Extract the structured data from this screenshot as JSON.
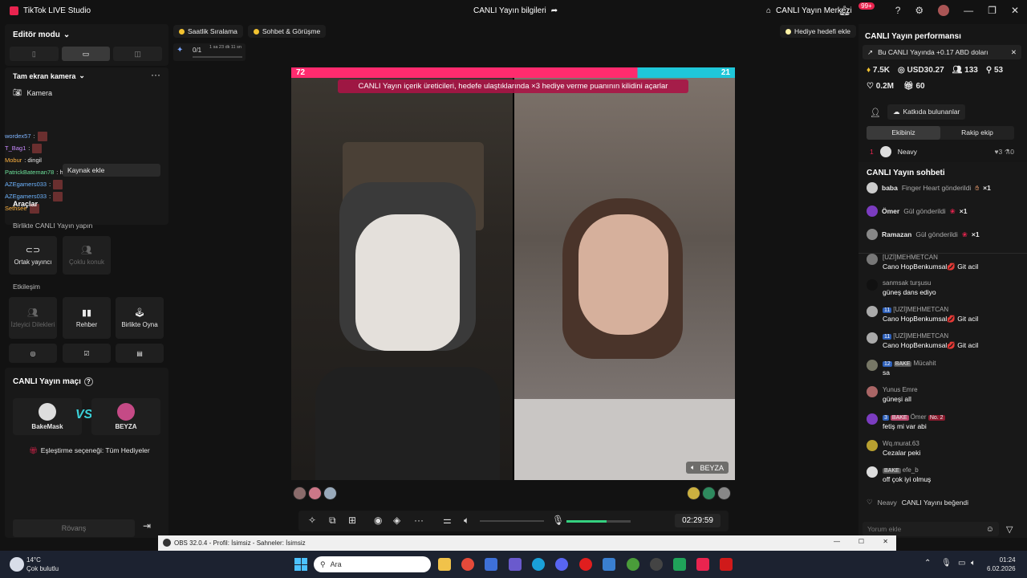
{
  "titlebar": {
    "app_title": "TikTok LIVE Studio",
    "center_title": "CANLI Yayın bilgileri",
    "live_center": "CANLI Yayın Merkezi",
    "notif_badge": "99+"
  },
  "left": {
    "editor_mode": "Editör modu",
    "fullscreen_camera": "Tam ekran kamera",
    "camera_label": "Kamera",
    "add_source": "Kaynak ekle",
    "tools_label": "Araçlar",
    "overlay_chat": [
      {
        "user": "wordex57",
        "text": ":"
      },
      {
        "user": "T_Bag1",
        "text": ":"
      },
      {
        "user": "Mobur",
        "text": ": dingil"
      },
      {
        "user": "PatrickBateman78",
        "text": ": he anladım"
      },
      {
        "user": "AZEgamers033",
        "text": ":"
      },
      {
        "user": "AZEgamers033",
        "text": ":"
      },
      {
        "user": "Sethsee",
        "text": ""
      }
    ],
    "live_together": "Birlikte CANLI Yayın yapın",
    "cohost": "Ortak yayıncı",
    "multi_guest": "Çoklu konuk",
    "interaction": "Etkileşim",
    "viewer_wishes": "İzleyici Dilekleri",
    "guide": "Rehber",
    "play_together": "Birlikte Oyna",
    "match_title": "CANLI Yayın maçı",
    "player1": "BakeMask",
    "player2": "BEYZA",
    "vs": "VS",
    "match_option": "Eşleştirme seçeneği: Tüm Hediyeler",
    "rematch": "Rövanş"
  },
  "top_pills": {
    "hourly_ranking": "Saatlik Sıralama",
    "chat_meet": "Sohbet & Görüşme",
    "add_gift_goal": "Hediye hedefi ekle",
    "progress": "0/1",
    "progress_time": "1 sa 23 dk 11 sn",
    "progress_value": 0
  },
  "stream": {
    "score_left": "72",
    "score_right": "21",
    "banner": "CANLI Yayın içerik üreticileri, hedefe ulaştıklarında ×3 hediye verme puanının kilidini açarlar",
    "guest_name": "BEYZA",
    "time": "02:29:59"
  },
  "right": {
    "performance_title": "CANLI Yayın performansı",
    "earn_note": "Bu CANLI Yayında +0.17 ABD doları",
    "stat_likes": "7.5K",
    "stat_usd": "USD30.27",
    "stat_viewers": "133",
    "stat_people": "53",
    "stat_views": "0.2M",
    "stat_gifts": "60",
    "contributors": "Katkıda bulunanlar",
    "tab_team": "Ekibiniz",
    "tab_rival": "Rakip ekip",
    "rank_row": {
      "rank": "1",
      "name": "Neavy",
      "hearts": "3",
      "gifts": "0"
    },
    "chat_title": "CANLI Yayın sohbeti",
    "gifts": [
      {
        "user": "baba",
        "text": "Finger Heart gönderildi",
        "count": "×1"
      },
      {
        "user": "Ömer",
        "text": "Gül gönderildi",
        "count": "×1"
      },
      {
        "user": "Ramazan",
        "text": "Gül gönderildi",
        "count": "×1"
      }
    ],
    "messages": [
      {
        "user": "[UZİ]MEHMETCAN",
        "level": "",
        "text": "Cano HopBenkumsal💋 Git acil"
      },
      {
        "user": "sanmsak turşusu",
        "level": "",
        "text": "güneş dans ediyo"
      },
      {
        "user": "[UZİ]MEHMETCAN",
        "level": "11",
        "text": "Cano HopBenkumsal💋 Git acil"
      },
      {
        "user": "[UZİ]MEHMETCAN",
        "level": "11",
        "text": "Cano HopBenkumsal💋 Git acil"
      },
      {
        "user": "Mücahit",
        "level": "12",
        "badge": "BAKE",
        "text": "sa"
      },
      {
        "user": "Yunus Emre",
        "level": "",
        "text": "güneşi all"
      },
      {
        "user": "Ömer",
        "level": "3",
        "badge": "BAKE",
        "extra": "No. 2",
        "text": "fetiş mi var abi"
      },
      {
        "user": "Wq.murat.63",
        "level": "",
        "text": "Cezalar peki"
      },
      {
        "user": "efe_b",
        "level": "",
        "badge": "BAKE",
        "text": "off çok iyi olmuş"
      }
    ],
    "liked": {
      "user": "Neavy",
      "text": "CANLI Yayını beğendi"
    },
    "comment_placeholder": "Yorum ekle"
  },
  "obs": {
    "title": "OBS 32.0.4 - Profil: İsimsiz - Sahneler: İsimsiz"
  },
  "taskbar": {
    "temp": "14°C",
    "weather": "Çok bulutlu",
    "search": "Ara",
    "time": "01:24",
    "date": "6.02.2026"
  },
  "colors": {
    "accent": "#e9244f",
    "rival": "#1fc7d9",
    "panel": "#181818"
  }
}
